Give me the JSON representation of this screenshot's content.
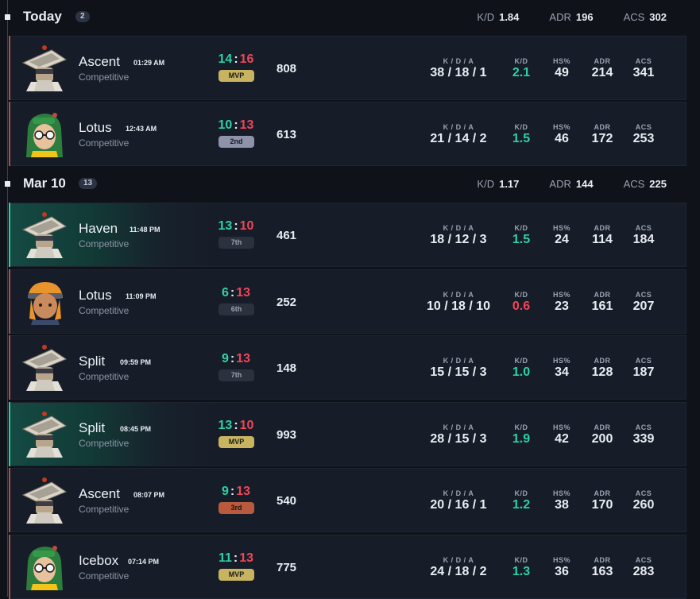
{
  "days": [
    {
      "title": "Today",
      "count": "2",
      "stats": {
        "kd_label": "K/D",
        "kd": "1.84",
        "adr_label": "ADR",
        "adr": "196",
        "acs_label": "ACS",
        "acs": "302"
      }
    },
    {
      "title": "Mar 10",
      "count": "13",
      "stats": {
        "kd_label": "K/D",
        "kd": "1.17",
        "adr_label": "ADR",
        "adr": "144",
        "acs_label": "ACS",
        "acs": "225"
      }
    }
  ],
  "labels": {
    "kda": "K / D / A",
    "kd": "K/D",
    "hs": "HS%",
    "adr": "ADR",
    "acs": "ACS"
  },
  "matches": [
    {
      "map": "Ascent",
      "time": "01:29 AM",
      "mode": "Competitive",
      "score_a": "14",
      "score_b": "16",
      "sep": ":",
      "place": "MVP",
      "rr": "808",
      "kda": "38 / 18 / 1",
      "kd": "2.1",
      "hs": "49",
      "adr": "214",
      "acs": "341",
      "result": "loss",
      "agent": "hat-agent-icon"
    },
    {
      "map": "Lotus",
      "time": "12:43 AM",
      "mode": "Competitive",
      "score_a": "10",
      "score_b": "13",
      "sep": ":",
      "place": "2nd",
      "rr": "613",
      "kda": "21 / 14 / 2",
      "kd": "1.5",
      "hs": "46",
      "adr": "172",
      "acs": "253",
      "result": "loss",
      "agent": "green-hood-agent-icon"
    },
    {
      "map": "Haven",
      "time": "11:48 PM",
      "mode": "Competitive",
      "score_a": "13",
      "score_b": "10",
      "sep": ":",
      "place": "7th",
      "rr": "461",
      "kda": "18 / 12 / 3",
      "kd": "1.5",
      "hs": "24",
      "adr": "114",
      "acs": "184",
      "result": "win",
      "agent": "hat-agent-icon"
    },
    {
      "map": "Lotus",
      "time": "11:09 PM",
      "mode": "Competitive",
      "score_a": "6",
      "score_b": "13",
      "sep": ":",
      "place": "6th",
      "rr": "252",
      "kda": "10 / 18 / 10",
      "kd": "0.6",
      "hs": "23",
      "adr": "161",
      "acs": "207",
      "result": "loss",
      "agent": "orange-cap-agent-icon"
    },
    {
      "map": "Split",
      "time": "09:59 PM",
      "mode": "Competitive",
      "score_a": "9",
      "score_b": "13",
      "sep": ":",
      "place": "7th",
      "rr": "148",
      "kda": "15 / 15 / 3",
      "kd": "1.0",
      "hs": "34",
      "adr": "128",
      "acs": "187",
      "result": "loss",
      "agent": "hat-agent-icon"
    },
    {
      "map": "Split",
      "time": "08:45 PM",
      "mode": "Competitive",
      "score_a": "13",
      "score_b": "10",
      "sep": ":",
      "place": "MVP",
      "rr": "993",
      "kda": "28 / 15 / 3",
      "kd": "1.9",
      "hs": "42",
      "adr": "200",
      "acs": "339",
      "result": "win",
      "agent": "hat-agent-icon"
    },
    {
      "map": "Ascent",
      "time": "08:07 PM",
      "mode": "Competitive",
      "score_a": "9",
      "score_b": "13",
      "sep": ":",
      "place": "3rd",
      "rr": "540",
      "kda": "20 / 16 / 1",
      "kd": "1.2",
      "hs": "38",
      "adr": "170",
      "acs": "260",
      "result": "loss",
      "agent": "hat-agent-icon"
    },
    {
      "map": "Icebox",
      "time": "07:14 PM",
      "mode": "Competitive",
      "score_a": "11",
      "score_b": "13",
      "sep": ":",
      "place": "MVP",
      "rr": "775",
      "kda": "24 / 18 / 2",
      "kd": "1.3",
      "hs": "36",
      "adr": "163",
      "acs": "283",
      "result": "loss",
      "agent": "green-hood-agent-icon"
    }
  ],
  "colors": {
    "win": "#2bd1a7",
    "loss": "#ef4558",
    "mvp": "#c7b360",
    "background": "#0f1218",
    "card": "#171d28"
  }
}
